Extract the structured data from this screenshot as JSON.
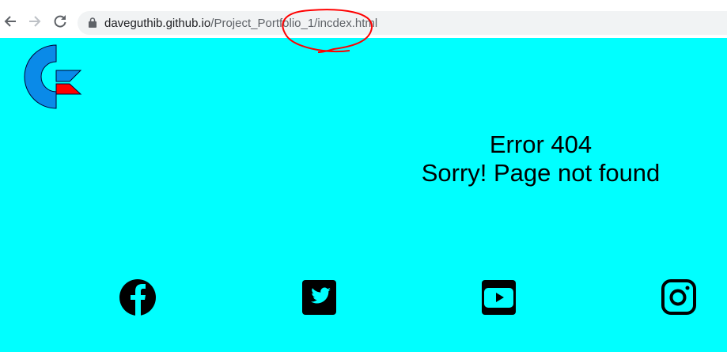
{
  "browser": {
    "url_domain": "daveguthib.github.io",
    "url_path": "/Project_Portfolio_1/incdex.html",
    "icons": [
      "back-arrow-icon",
      "forward-arrow-icon",
      "reload-icon",
      "lock-icon"
    ],
    "annotation_color": "#ff0000"
  },
  "page": {
    "background": "#00ffff",
    "error_code": "Error 404",
    "error_message": "Sorry! Page not found",
    "logo_colors": {
      "blue": "#0a8ae8",
      "red": "#ff0000"
    },
    "social": [
      "facebook-icon",
      "twitter-icon",
      "youtube-icon",
      "instagram-icon"
    ]
  }
}
